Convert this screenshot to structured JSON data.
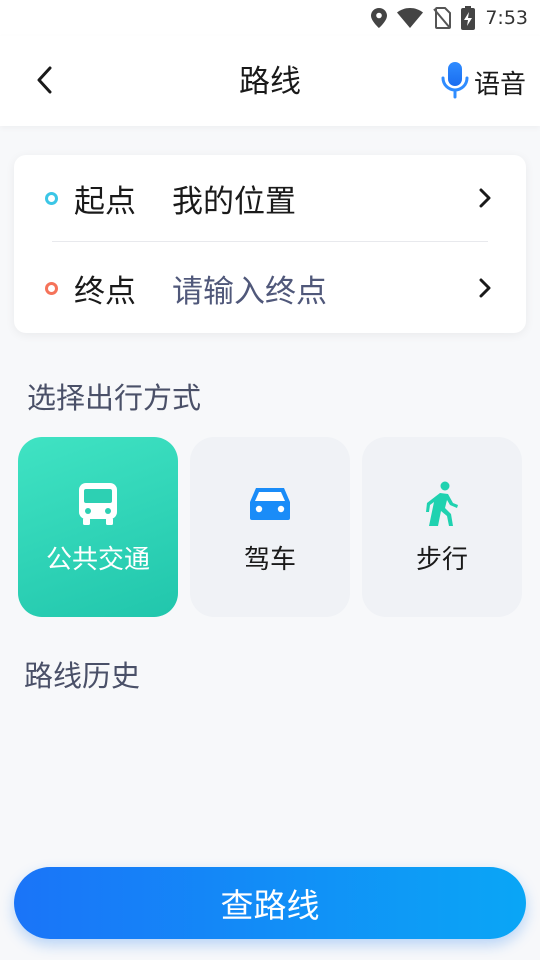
{
  "status_bar": {
    "time": "7:53",
    "icons": [
      "location-icon",
      "wifi-icon",
      "no-sim-icon",
      "battery-charging-icon"
    ]
  },
  "header": {
    "title": "路线",
    "voice_label": "语音",
    "back_icon": "back-chevron-icon",
    "voice_icon": "microphone-icon"
  },
  "route": {
    "start_label": "起点",
    "start_value": "我的位置",
    "end_label": "终点",
    "end_placeholder": "请输入终点",
    "start_dot_color": "#3cc6e6",
    "end_dot_color": "#f5735a"
  },
  "mode_section": {
    "title": "选择出行方式",
    "modes": [
      {
        "label": "公共交通",
        "icon": "bus-icon",
        "selected": true,
        "color": "#2fd6b6"
      },
      {
        "label": "驾车",
        "icon": "car-icon",
        "selected": false,
        "color": "#1a8cf8"
      },
      {
        "label": "步行",
        "icon": "walk-icon",
        "selected": false,
        "color": "#1fd2b0"
      }
    ]
  },
  "history_section": {
    "title": "路线历史"
  },
  "search_button": {
    "label": "查路线"
  },
  "colors": {
    "accent_blue": "#1a74f8",
    "accent_teal": "#2fd6b6"
  }
}
